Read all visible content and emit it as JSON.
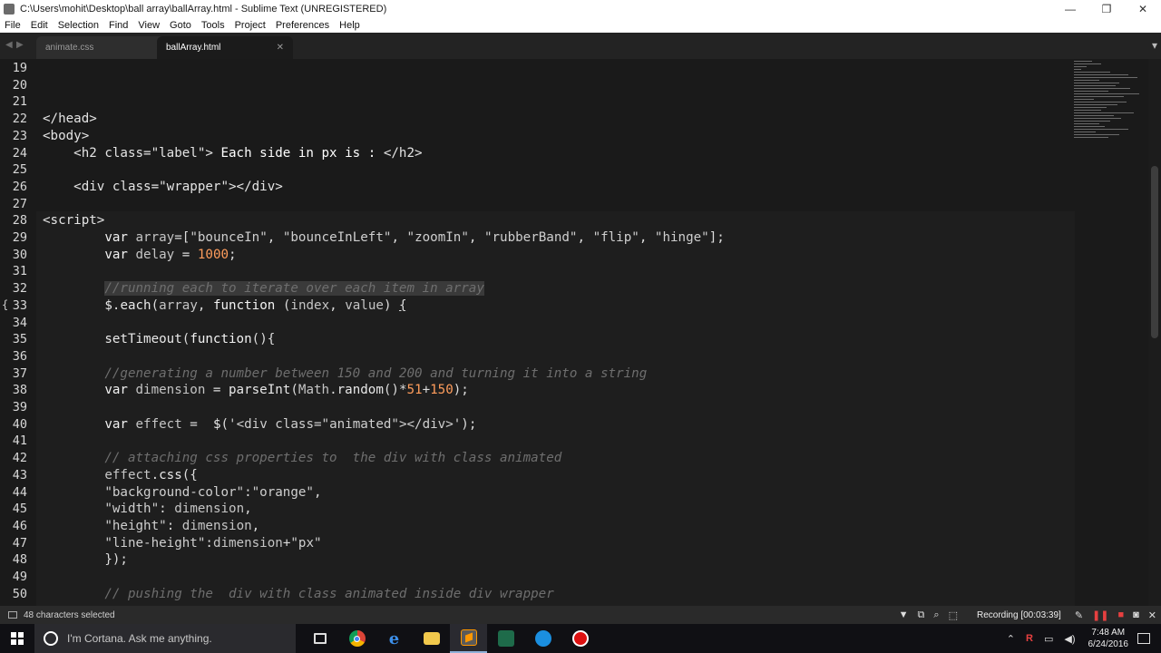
{
  "window": {
    "title": "C:\\Users\\mohit\\Desktop\\ball array\\ballArray.html - Sublime Text (UNREGISTERED)",
    "minimize": "—",
    "maximize": "❐",
    "close": "✕"
  },
  "menu": [
    "File",
    "Edit",
    "Selection",
    "Find",
    "View",
    "Goto",
    "Tools",
    "Project",
    "Preferences",
    "Help"
  ],
  "tabs": [
    {
      "label": "animate.css",
      "active": false
    },
    {
      "label": "ballArray.html",
      "active": true
    }
  ],
  "editor": {
    "lines": [
      {
        "n": "19",
        "html": ""
      },
      {
        "n": "20",
        "html": ""
      },
      {
        "n": "21",
        "html": ""
      },
      {
        "n": "22",
        "html": "<span class='t-tag'>&lt;/head&gt;</span>"
      },
      {
        "n": "23",
        "html": "<span class='t-tag'>&lt;body&gt;</span>"
      },
      {
        "n": "24",
        "html": "    <span class='t-tag'>&lt;h2 class=\"label\"&gt;</span><span class='t-white'> Each side in px is : </span><span class='t-tag'>&lt;/h2&gt;</span>"
      },
      {
        "n": "25",
        "html": ""
      },
      {
        "n": "26",
        "html": "    <span class='t-tag'>&lt;div class=\"wrapper\"&gt;&lt;/div&gt;</span>"
      },
      {
        "n": "27",
        "html": ""
      },
      {
        "n": "28",
        "html": "<span class='t-tag'>&lt;script&gt;</span>"
      },
      {
        "n": "29",
        "html": "        <span class='t-kw'>var</span> <span class='t-var'>array</span>=[<span class='t-str'>\"bounceIn\"</span>, <span class='t-str'>\"bounceInLeft\"</span>, <span class='t-str'>\"zoomIn\"</span>, <span class='t-str'>\"rubberBand\"</span>, <span class='t-str'>\"flip\"</span>, <span class='t-str'>\"hinge\"</span>];"
      },
      {
        "n": "30",
        "html": "        <span class='t-kw'>var</span> <span class='t-var'>delay</span> = <span class='t-num'>1000</span>;"
      },
      {
        "n": "31",
        "html": ""
      },
      {
        "n": "32",
        "html": "        <span class='t-cmt sel'>//running each to iterate over each item in array</span>"
      },
      {
        "n": "33",
        "html": "        <span class='t-fn'>$</span>.<span class='t-fn'>each</span>(<span class='t-var'>array</span>, <span class='t-kw'>function</span> (<span class='t-var'>index</span>, <span class='t-var'>value</span>) <span style='text-decoration:underline'>{</span>"
      },
      {
        "n": "34",
        "html": ""
      },
      {
        "n": "35",
        "html": "        <span class='t-fn'>setTimeout</span>(<span class='t-kw'>function</span>(){"
      },
      {
        "n": "36",
        "html": ""
      },
      {
        "n": "37",
        "html": "        <span class='t-cmt'>//generating a number between 150 and 200 and turning it into a string</span>"
      },
      {
        "n": "38",
        "html": "        <span class='t-kw'>var</span> <span class='t-var'>dimension</span> = <span class='t-fn'>parseInt</span>(<span class='t-var'>Math</span>.<span class='t-fn'>random</span>()*<span class='t-num'>51</span>+<span class='t-num'>150</span>);"
      },
      {
        "n": "39",
        "html": ""
      },
      {
        "n": "40",
        "html": "        <span class='t-kw'>var</span> <span class='t-var'>effect</span> =  <span class='t-fn'>$</span>(<span class='t-str'>'&lt;div class=\"animated\"&gt;&lt;/div&gt;'</span>);"
      },
      {
        "n": "41",
        "html": ""
      },
      {
        "n": "42",
        "html": "        <span class='t-cmt'>// attaching css properties to  the div with class animated</span>"
      },
      {
        "n": "43",
        "html": "        <span class='t-var'>effect</span>.<span class='t-fn'>css</span>({"
      },
      {
        "n": "44",
        "html": "        <span class='t-str'>\"background-color\"</span>:<span class='t-str'>\"orange\"</span>,"
      },
      {
        "n": "45",
        "html": "        <span class='t-str'>\"width\"</span>: <span class='t-var'>dimension</span>,"
      },
      {
        "n": "46",
        "html": "        <span class='t-str'>\"height\"</span>: <span class='t-var'>dimension</span>,"
      },
      {
        "n": "47",
        "html": "        <span class='t-str'>\"line-height\"</span>:<span class='t-var'>dimension</span>+<span class='t-str'>\"px\"</span>"
      },
      {
        "n": "48",
        "html": "        });"
      },
      {
        "n": "49",
        "html": ""
      },
      {
        "n": "50",
        "html": "        <span class='t-cmt'>// pushing the  div with class animated inside div wrapper</span>"
      }
    ]
  },
  "status": {
    "selection": "48 characters selected",
    "recording": "Recording [00:03:39]"
  },
  "taskbar": {
    "cortana_placeholder": "I'm Cortana. Ask me anything.",
    "time": "7:48 AM",
    "date": "6/24/2016"
  }
}
